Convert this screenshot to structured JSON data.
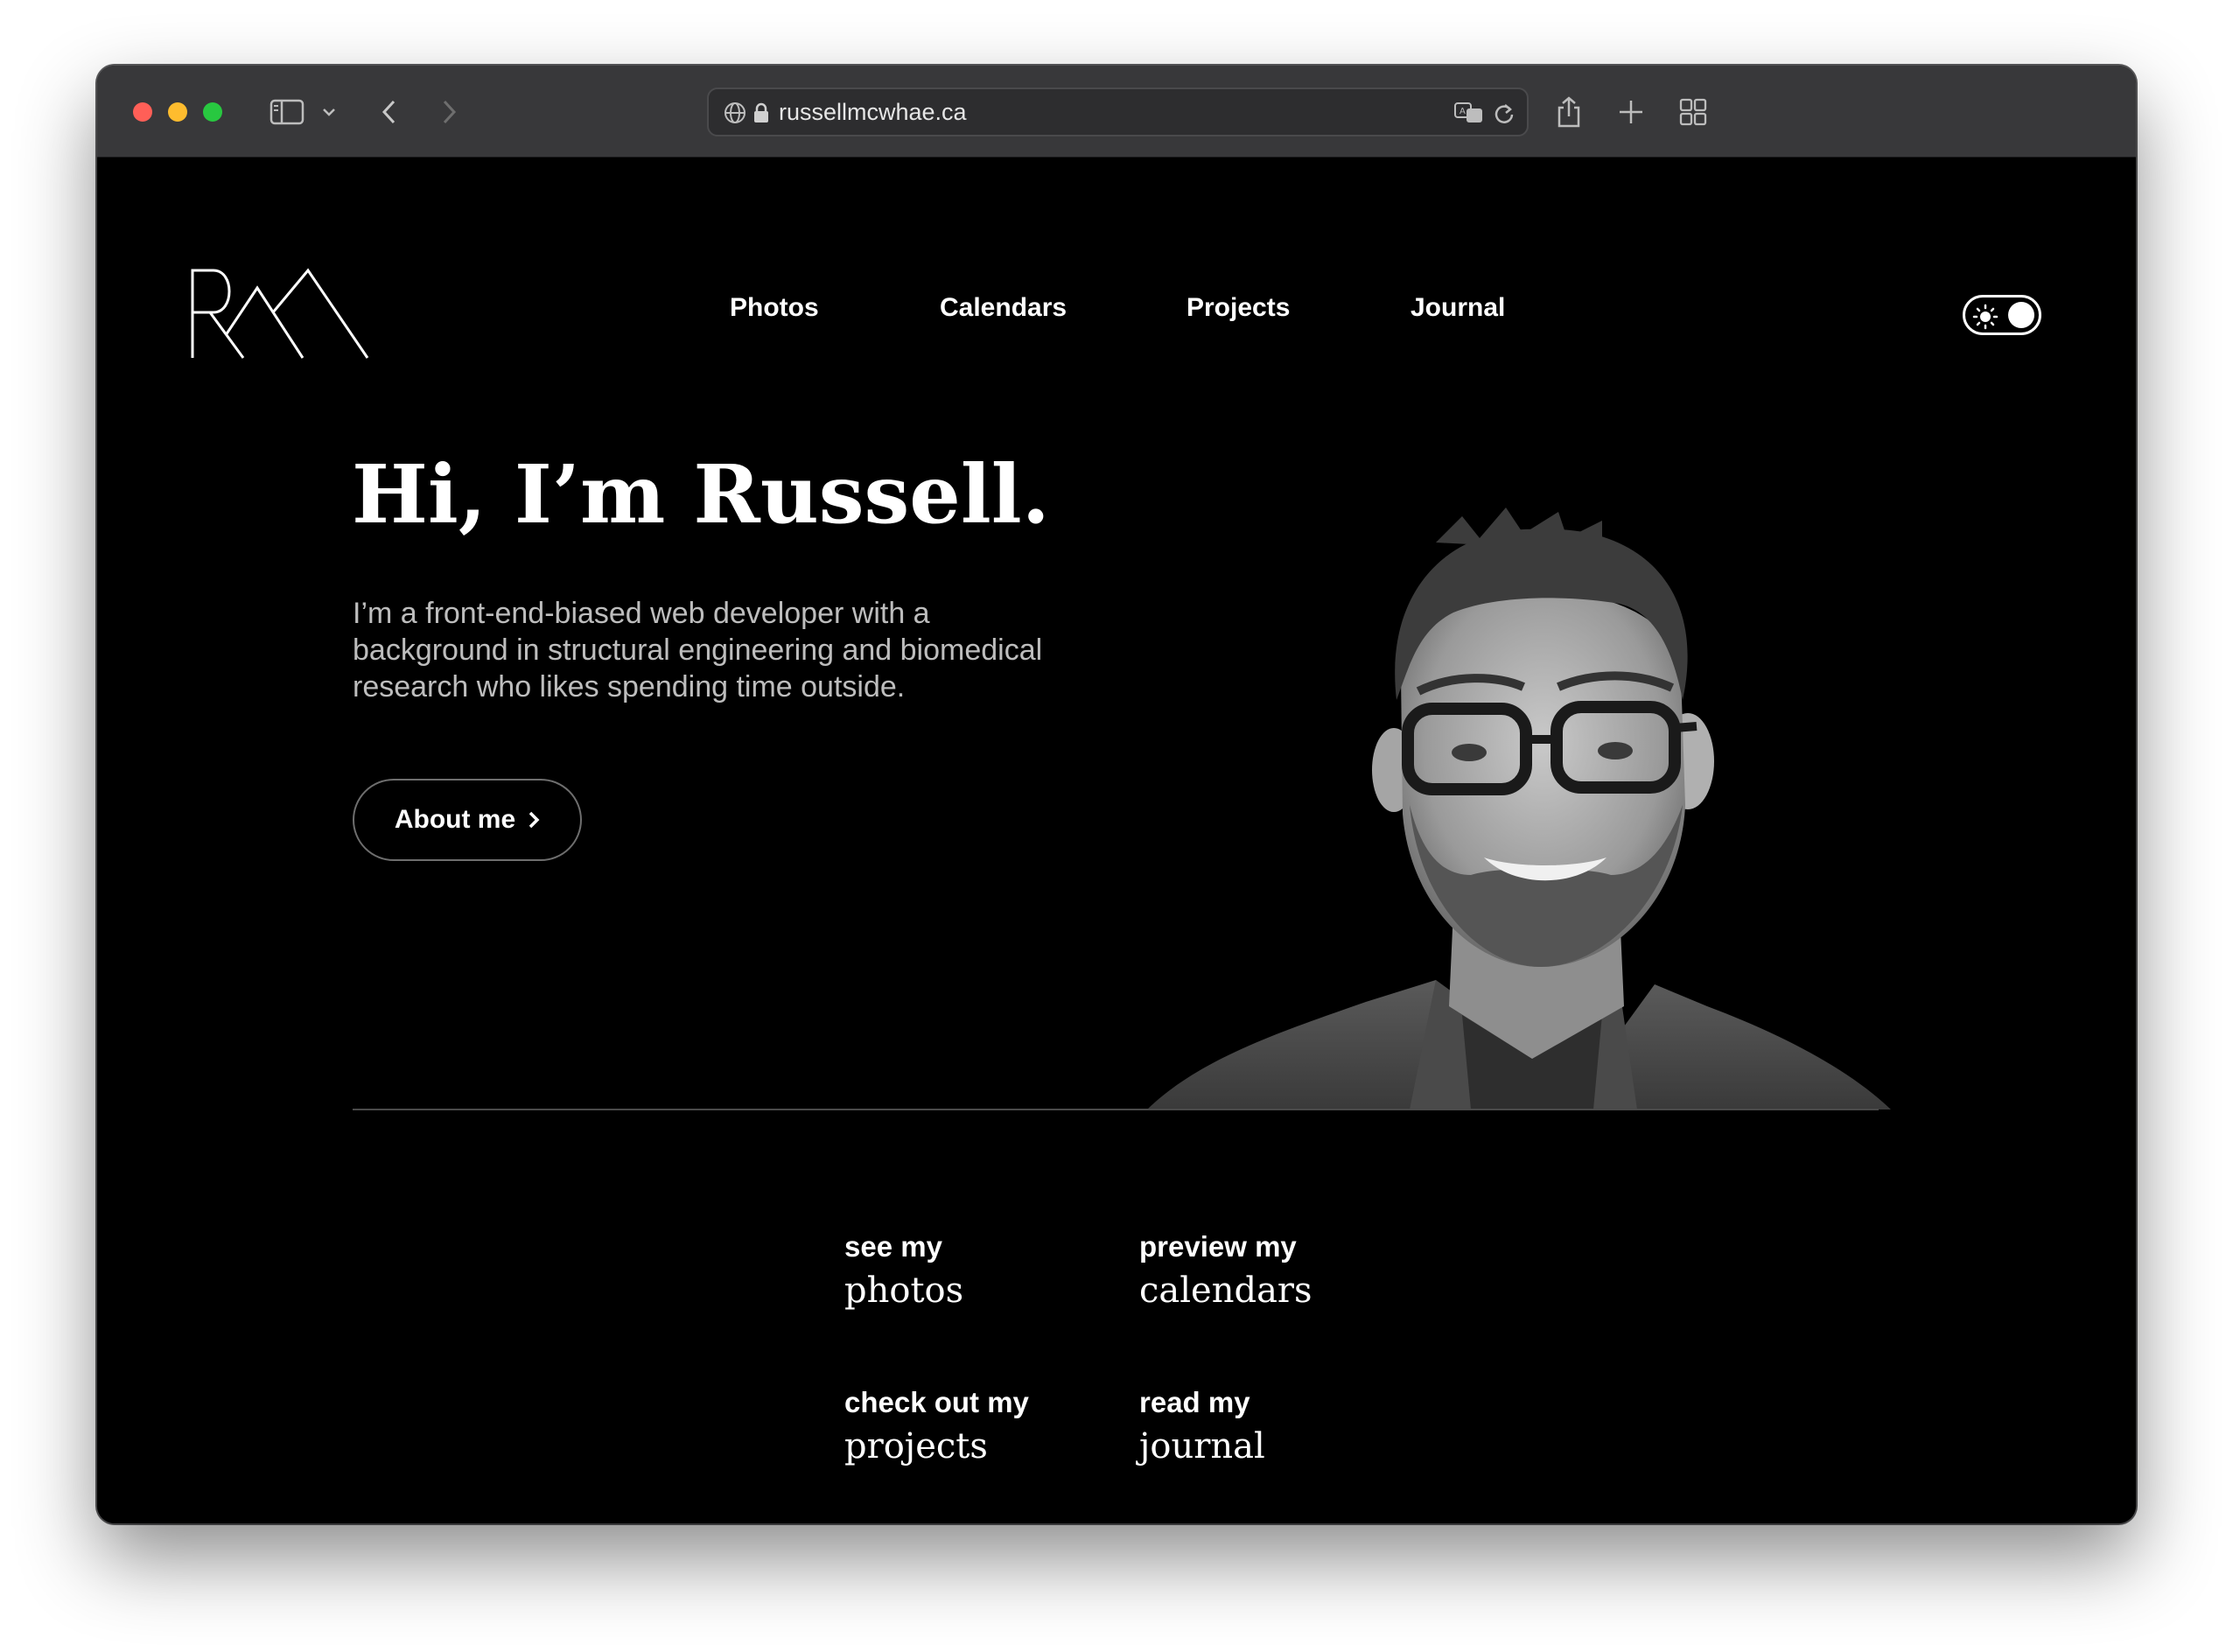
{
  "browser": {
    "url": "russellmcwhae.ca"
  },
  "site": {
    "logo_text": "RM",
    "nav": [
      {
        "label": "Photos"
      },
      {
        "label": "Calendars"
      },
      {
        "label": "Projects"
      },
      {
        "label": "Journal"
      }
    ]
  },
  "hero": {
    "title": "Hi, I’m Russell.",
    "description": "I’m a front-end-biased web developer with a background in structural engineering and biomedical research who likes spending time outside.",
    "cta_label": "About me"
  },
  "cards": [
    {
      "kicker": "see my",
      "title": "photos"
    },
    {
      "kicker": "preview my",
      "title": "calendars"
    },
    {
      "kicker": "check out my",
      "title": "projects"
    },
    {
      "kicker": "read my",
      "title": "journal"
    }
  ],
  "colors": {
    "background": "#000000",
    "text": "#ffffff",
    "muted_text": "#bdbdbd",
    "toolbar": "#38383a"
  }
}
